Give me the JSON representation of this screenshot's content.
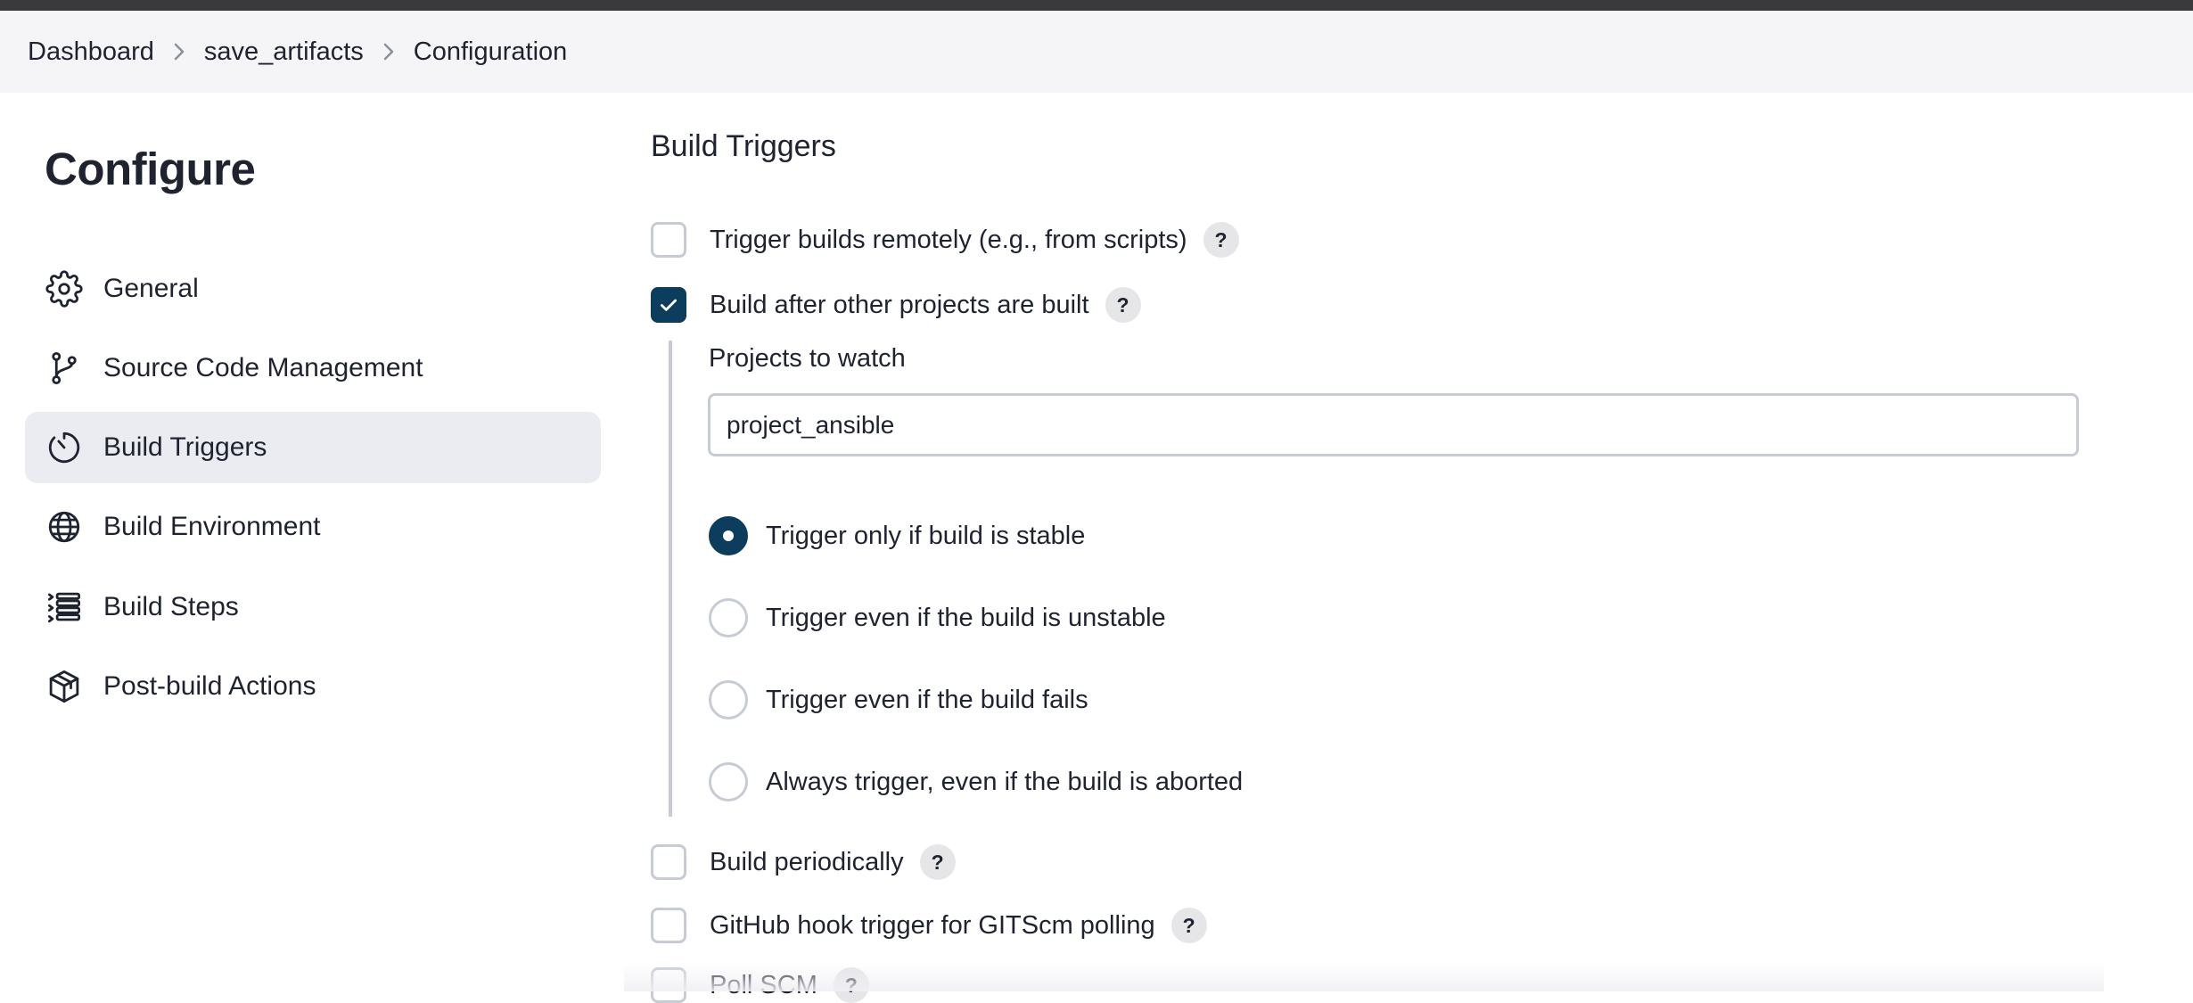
{
  "breadcrumb": {
    "items": [
      "Dashboard",
      "save_artifacts",
      "Configuration"
    ]
  },
  "sidebar": {
    "title": "Configure",
    "items": [
      {
        "label": "General",
        "icon": "gear-icon"
      },
      {
        "label": "Source Code Management",
        "icon": "git-branch-icon"
      },
      {
        "label": "Build Triggers",
        "icon": "timer-icon",
        "active": true
      },
      {
        "label": "Build Environment",
        "icon": "globe-icon"
      },
      {
        "label": "Build Steps",
        "icon": "list-icon"
      },
      {
        "label": "Post-build Actions",
        "icon": "package-icon"
      }
    ]
  },
  "main": {
    "section_title": "Build Triggers",
    "options": [
      {
        "label": "Trigger builds remotely (e.g., from scripts)",
        "checked": false
      },
      {
        "label": "Build after other projects are built",
        "checked": true
      },
      {
        "label": "Build periodically",
        "checked": false
      },
      {
        "label": "GitHub hook trigger for GITScm polling",
        "checked": false
      },
      {
        "label": "Poll SCM",
        "checked": false
      }
    ],
    "help_label": "?",
    "projects_to_watch": {
      "label": "Projects to watch",
      "value": "project_ansible"
    },
    "radio_options": [
      {
        "label": "Trigger only if build is stable",
        "selected": true
      },
      {
        "label": "Trigger even if the build is unstable",
        "selected": false
      },
      {
        "label": "Trigger even if the build fails",
        "selected": false
      },
      {
        "label": "Always trigger, even if the build is aborted",
        "selected": false
      }
    ]
  },
  "colors": {
    "accent": "#0d3d5c",
    "active_nav_bg": "#ebecf1",
    "breadcrumb_bg": "#f5f5f7"
  }
}
